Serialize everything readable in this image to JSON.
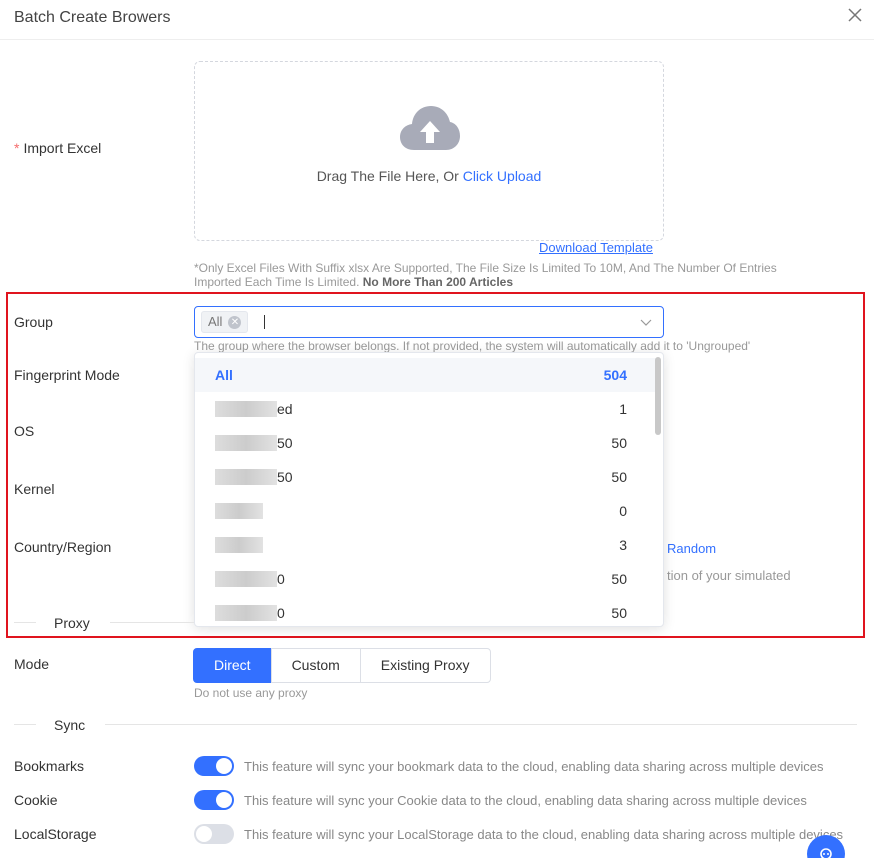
{
  "dialog": {
    "title": "Batch Create Browers"
  },
  "import": {
    "required_mark": "*",
    "label": "Import Excel",
    "drag_text": "Drag The File Here, Or ",
    "click_upload": "Click Upload",
    "download_template": "Download Template",
    "hint_line1": "*Only Excel Files With Suffix xlsx Are Supported, The File Size Is Limited To 10M, And The Number Of Entries",
    "hint_line2": "Imported Each Time Is Limited.",
    "hint_bold": "No More Than 200 Articles"
  },
  "group": {
    "label": "Group",
    "tag": "All",
    "hint": "The group where the browser belongs. If not provided, the system will automatically add it to 'Ungrouped'",
    "options": [
      {
        "name": "All",
        "count": "504",
        "selected": true
      },
      {
        "name": "ed",
        "count": "1"
      },
      {
        "name": "50",
        "count": "50"
      },
      {
        "name": "50",
        "count": "50"
      },
      {
        "name": "",
        "count": "0"
      },
      {
        "name": "",
        "count": "3"
      },
      {
        "name": "0",
        "count": "50"
      },
      {
        "name": "0",
        "count": "50"
      }
    ]
  },
  "fields": {
    "fingerprint_mode": "Fingerprint Mode",
    "os": "OS",
    "kernel": "Kernel",
    "country_region": "Country/Region",
    "random": "Random",
    "country_hint_partial": "tion of your simulated"
  },
  "proxy": {
    "section": "Proxy",
    "mode_label": "Mode",
    "buttons": [
      "Direct",
      "Custom",
      "Existing Proxy"
    ],
    "active": "Direct",
    "hint": "Do not use any proxy"
  },
  "sync": {
    "section": "Sync",
    "items": [
      {
        "label": "Bookmarks",
        "enabled": true,
        "desc": "This feature will sync your bookmark data to the cloud, enabling data sharing across multiple devices"
      },
      {
        "label": "Cookie",
        "enabled": true,
        "desc": "This feature will sync your Cookie data to the cloud, enabling data sharing across multiple devices"
      },
      {
        "label": "LocalStorage",
        "enabled": false,
        "desc": "This feature will sync your LocalStorage data to the cloud, enabling data sharing across multiple devices"
      }
    ]
  },
  "colors": {
    "accent": "#3370ff",
    "required": "#f56c6c",
    "highlight_box": "#e0141e"
  }
}
